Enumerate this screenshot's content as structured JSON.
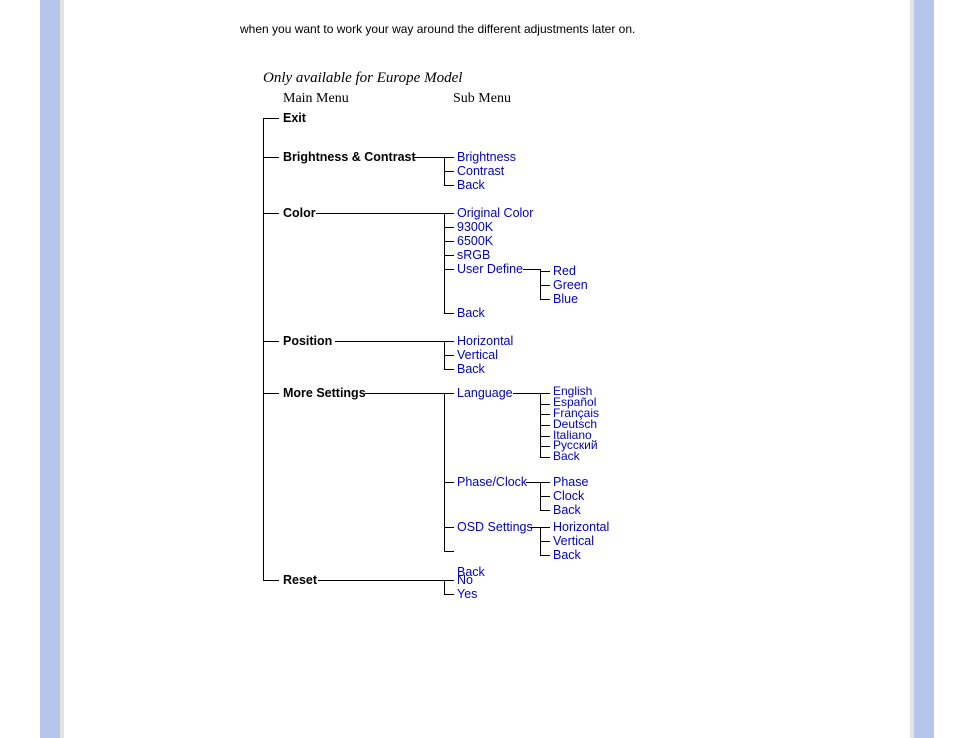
{
  "intro": "when you want to work your way around the different adjustments later on.",
  "title": "Only available for Europe Model",
  "headers": {
    "main": "Main Menu",
    "sub": "Sub Menu"
  },
  "main": {
    "exit": "Exit",
    "brightness": "Brightness & Contrast",
    "color": "Color",
    "position": "Position",
    "more": "More Settings",
    "reset": "Reset"
  },
  "sub": {
    "brightness": "Brightness",
    "contrast": "Contrast",
    "back1": "Back",
    "origcolor": "Original Color",
    "c9300": "9300K",
    "c6500": "6500K",
    "srgb": "sRGB",
    "userdef": "User Define",
    "red": "Red",
    "green": "Green",
    "blue": "Blue",
    "back2": "Back",
    "horiz": "Horizontal",
    "vert": "Vertical",
    "back3": "Back",
    "language": "Language",
    "lang": {
      "en": "English",
      "es": "Español",
      "fr": "Français",
      "de": "Deutsch",
      "it": "Italiano",
      "ru": "Русский",
      "back": "Back"
    },
    "phaseclock": "Phase/Clock",
    "phase": "Phase",
    "clock": "Clock",
    "back4": "Back",
    "osd": "OSD Settings",
    "osd_h": "Horizontal",
    "osd_v": "Vertical",
    "osd_back": "Back",
    "back5": "Back",
    "no": "No",
    "yes": "Yes"
  }
}
